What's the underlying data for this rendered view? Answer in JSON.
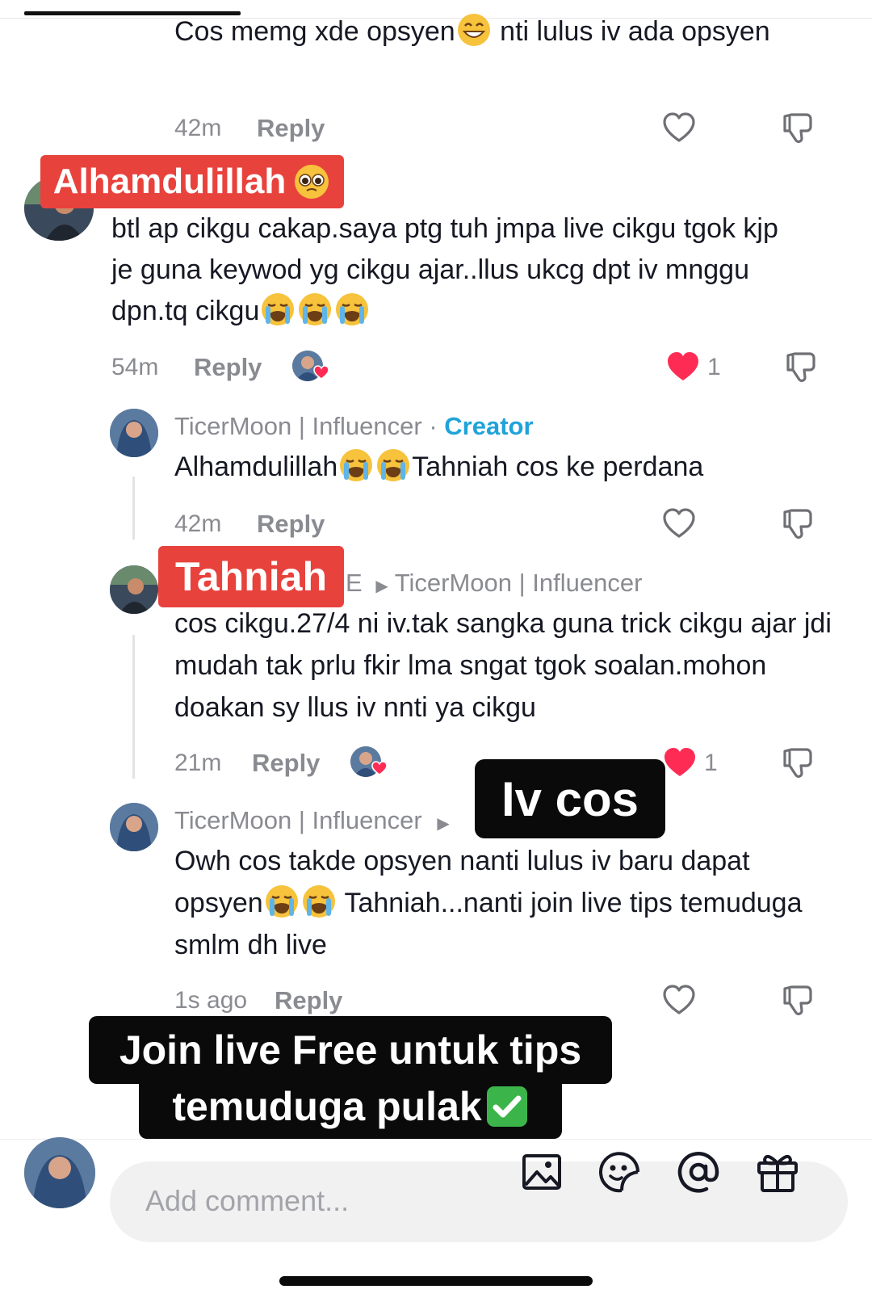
{
  "comment1": {
    "text": "Cos memg xde opsyen",
    "text_after": " nti lulus iv ada opsyen",
    "time": "42m",
    "reply_label": "Reply"
  },
  "comment2": {
    "text": "btl ap cikgu cakap.saya ptg tuh jmpa live cikgu tgok kjp je guna keywod yg cikgu ajar..llus ukcg dpt iv mnggu dpn.tq cikgu",
    "time": "54m",
    "reply_label": "Reply",
    "like_count": "1"
  },
  "reply1": {
    "username": "TicerMoon | Influencer",
    "separator": " · ",
    "badge": "Creator",
    "text_before": "Alhamdulillah",
    "text_after": "Tahniah cos ke perdana",
    "time": "42m",
    "reply_label": "Reply"
  },
  "reply2": {
    "username_prefix": "E",
    "reply_to": "TicerMoon | Influencer",
    "text": "cos cikgu.27/4 ni iv.tak sangka guna trick cikgu ajar jdi mudah tak prlu fkir lma sngat tgok soalan.mohon doakan sy llus iv nnti ya cikgu",
    "time": "21m",
    "reply_label": "Reply",
    "like_count": "1"
  },
  "reply3": {
    "username": "TicerMoon | Influencer",
    "text_before": "Owh cos takde opsyen nanti lulus iv baru dapat opsyen",
    "text_after": " Tahniah...nanti join live tips temuduga smlm dh live",
    "time": "1s ago",
    "reply_label": "Reply"
  },
  "overlays": {
    "alhamdulillah": "Alhamdulillah",
    "tahniah": "Tahniah",
    "iv_cos": "Iv cos",
    "caption_line1": "Join live Free untuk tips",
    "caption_line2": "temuduga pulak"
  },
  "composer": {
    "placeholder": "Add comment..."
  },
  "icons": [
    "heart-icon",
    "dislike-icon",
    "image-icon",
    "emoji-icon",
    "mention-icon",
    "gift-icon",
    "check-mark-icon"
  ],
  "colors": {
    "like_red": "#fe2c55",
    "creator_blue": "#20a3d9",
    "label_red": "#e8423d",
    "label_black": "#0a0a0a"
  }
}
